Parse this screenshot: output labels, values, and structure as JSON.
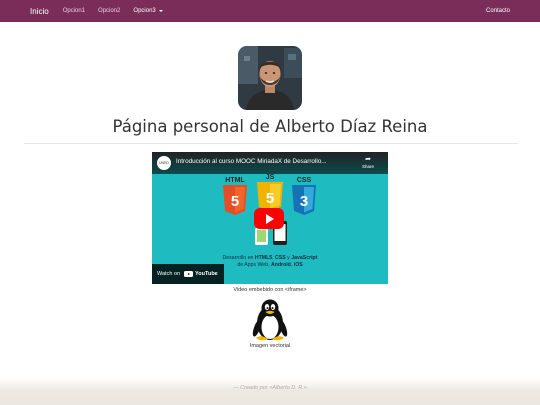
{
  "navbar": {
    "brand": "Inicio",
    "items": [
      {
        "label": "Opcion1"
      },
      {
        "label": "Opcion2"
      },
      {
        "label": "Opcion3"
      }
    ],
    "right_link": "Contacto",
    "color": "#7b2d5a"
  },
  "profile": {
    "title": "Página personal de Alberto Díaz Reina"
  },
  "video": {
    "title": "Introducción al curso MOOC MiriadaX de Desarrollo...",
    "share_label": "Share",
    "watch_on": "Watch on",
    "youtube_word": "YouTube",
    "logos": {
      "html": "HTML",
      "js": "JS",
      "css": "CSS"
    },
    "caption_prefix": "Desarrollo en ",
    "caption_html5": "HTML5",
    "caption_sep1": ", ",
    "caption_css3": "CSS",
    "caption_and": " y ",
    "caption_js": "JavaScript",
    "caption_line2_prefix": "de Apps Web, ",
    "caption_android": "Android",
    "caption_sep2": ", ",
    "caption_ios": "iOS",
    "embed_caption": "Video embebido con <iframe>"
  },
  "image": {
    "caption": "Imagen vectorial"
  },
  "footer": {
    "text": "— Creado por «Alberto D. R.»"
  }
}
